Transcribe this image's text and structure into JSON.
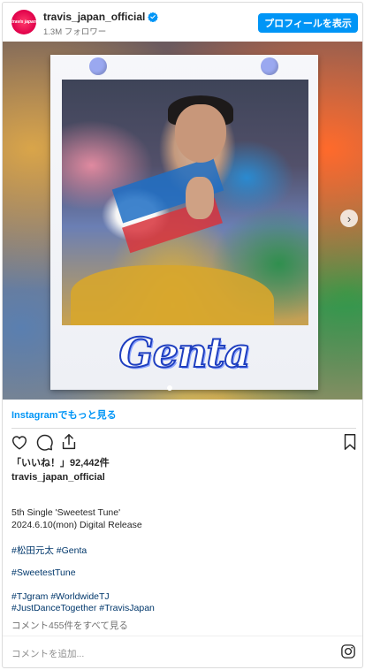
{
  "header": {
    "avatar_text": "travis japan",
    "username": "travis_japan_official",
    "followers": "1.3M フォロワー",
    "profile_button": "プロフィールを表示"
  },
  "media": {
    "name_text": "Genta",
    "next_icon": "chevron-right-icon"
  },
  "more_link": "Instagramでもっと見る",
  "actions": {
    "icons": [
      "heart-icon",
      "comment-icon",
      "share-icon",
      "bookmark-icon"
    ]
  },
  "likes": "「いいね！」92,442件",
  "caption": {
    "username": "travis_japan_official",
    "line1": "5th Single 'Sweetest Tune'",
    "line2": "2024.6.10(mon) Digital Release",
    "tags1": "#松田元太 #Genta",
    "tags2": "#SweetestTune",
    "tags3": "#TJgram #WorldwideTJ",
    "tags4": "#JustDanceTogether #TravisJapan"
  },
  "comments_link": "コメント455件をすべて見る",
  "comment_placeholder": "コメントを追加...",
  "colors": {
    "accent": "#0095f6",
    "verified": "#0095f6",
    "hashtag": "#00376b"
  }
}
